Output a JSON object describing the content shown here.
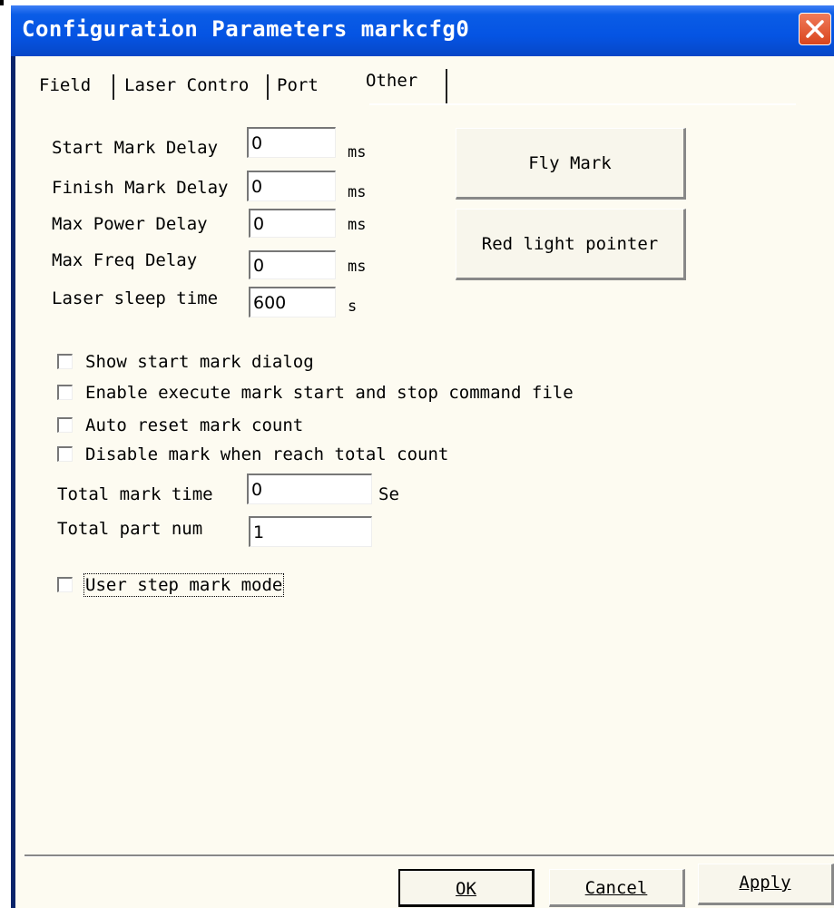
{
  "window": {
    "title": "Configuration Parameters markcfg0"
  },
  "tabs": [
    {
      "label": "Field",
      "active": false
    },
    {
      "label": "Laser Contro",
      "active": false
    },
    {
      "label": "Port",
      "active": false
    },
    {
      "label": "Other",
      "active": true
    }
  ],
  "delays": [
    {
      "label": "Start Mark Delay",
      "value": "0",
      "unit": "ms"
    },
    {
      "label": "Finish Mark Delay",
      "value": "0",
      "unit": "ms"
    },
    {
      "label": "Max Power Delay",
      "value": "0",
      "unit": "ms"
    },
    {
      "label": "Max Freq Delay",
      "value": "0",
      "unit": "ms"
    },
    {
      "label": "Laser sleep time",
      "value": "600",
      "unit": "s"
    }
  ],
  "buttons": {
    "fly_mark": "Fly Mark",
    "red_light": "Red light pointer"
  },
  "checkboxes": [
    {
      "label": "Show start mark dialog",
      "checked": false
    },
    {
      "label": "Enable execute mark start and stop command file",
      "checked": false
    },
    {
      "label": "Auto reset mark count",
      "checked": false
    },
    {
      "label": "Disable mark when reach total count",
      "checked": false
    }
  ],
  "totals": {
    "mark_time": {
      "label": "Total mark time",
      "value": "0",
      "unit": "Se"
    },
    "part_num": {
      "label": "Total part num",
      "value": "1"
    }
  },
  "step_mode": {
    "label": "User step mark mode",
    "checked": false
  },
  "footer": {
    "ok": "OK",
    "cancel": "Cancel",
    "apply": "Apply"
  },
  "colors": {
    "titlebar": "#0554e3",
    "client_bg": "#fdfbf1",
    "close_button": "#d9451d"
  },
  "icons": {
    "close": "close-x-icon"
  }
}
